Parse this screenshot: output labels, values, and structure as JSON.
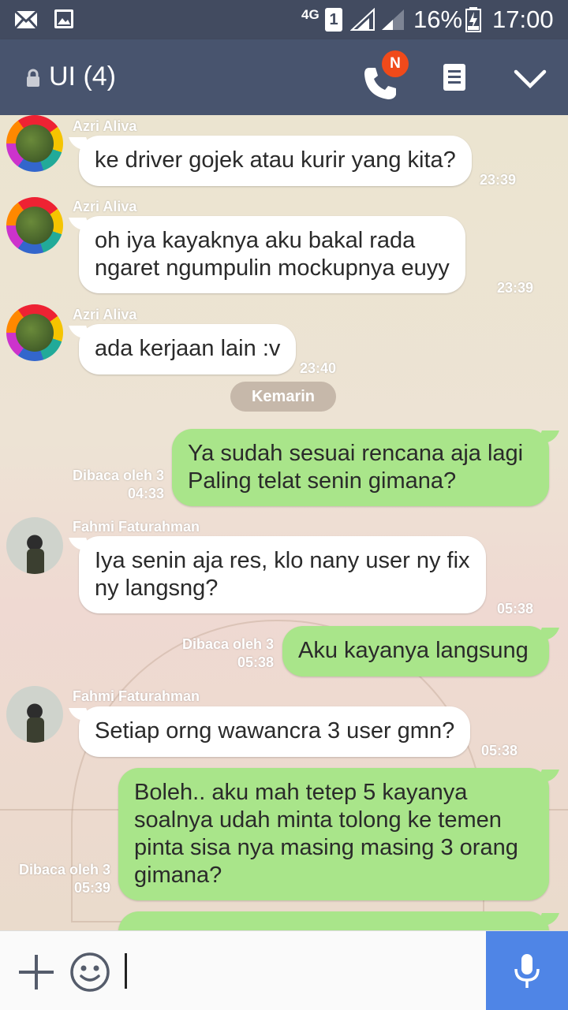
{
  "status_bar": {
    "network": "4G",
    "sim": "1",
    "battery": "16%",
    "time": "17:00"
  },
  "header": {
    "title": "UI (4)",
    "call_badge": "N"
  },
  "date_divider": "Kemarin",
  "messages": [
    {
      "sender": "Azri Aliva",
      "text_lines": [
        "ke driver gojek atau kurir yang kita?"
      ],
      "time": "23:39"
    },
    {
      "sender": "Azri Aliva",
      "text_lines": [
        "oh iya kayaknya aku bakal rada",
        "ngaret ngumpulin mockupnya euyy"
      ],
      "time": "23:39"
    },
    {
      "sender": "Azri Aliva",
      "text_lines": [
        "ada kerjaan lain :v"
      ],
      "time": "23:40"
    },
    {
      "read": "Dibaca oleh 3",
      "text_lines": [
        "Ya sudah sesuai rencana aja lagi",
        "Paling telat senin gimana?"
      ],
      "time": "04:33"
    },
    {
      "sender": "Fahmi Faturahman",
      "text_lines": [
        "Iya senin aja res, klo nany user ny fix",
        "ny langsng?"
      ],
      "time": "05:38"
    },
    {
      "read": "Dibaca oleh 3",
      "text_lines": [
        "Aku kayanya langsung"
      ],
      "time": "05:38"
    },
    {
      "sender": "Fahmi Faturahman",
      "text_lines": [
        "Setiap orng wawancra 3 user gmn?"
      ],
      "time": "05:38"
    },
    {
      "read": "Dibaca oleh 3",
      "text_lines": [
        "Boleh.. aku mah tetep 5 kayanya",
        "soalnya udah minta tolong ke temen",
        "pinta sisa nya masing masing 3 orang",
        "gimana?"
      ],
      "time": "05:39"
    }
  ]
}
